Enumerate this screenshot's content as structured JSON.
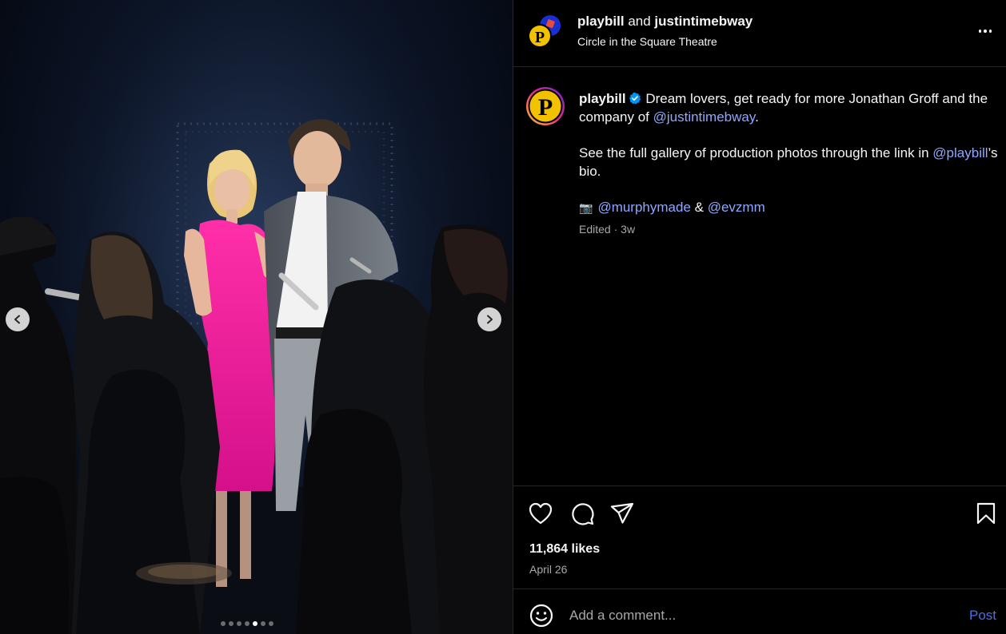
{
  "post": {
    "author": "playbill",
    "and_text": "and",
    "collaborator": "justintimebway",
    "location": "Circle in the Square Theatre"
  },
  "media": {
    "slide_count": 7,
    "active_slide": 5
  },
  "caption": {
    "username": "playbill",
    "line1_text": "Dream lovers, get ready for more Jonathan Groff and the company of ",
    "line1_mention": "@justintimebway",
    "line1_end": ".",
    "line2_text": "See the full gallery of production photos through the link in ",
    "line2_mention": "@playbill",
    "line2_end": "’s bio.",
    "camera_emoji": "📷",
    "credit1": "@murphymade",
    "credit_joiner": " & ",
    "credit2": "@evzmm",
    "edited": "Edited",
    "separator": " · ",
    "time_ago": "3w"
  },
  "engagement": {
    "likes": "11,864 likes",
    "date": "April 26"
  },
  "comment": {
    "placeholder": "Add a comment...",
    "post_label": "Post"
  },
  "colors": {
    "background": "#000000",
    "link": "#8fa7ff",
    "post_button": "#4a6fe0",
    "playbill_yellow": "#f2c200",
    "verified_blue": "#0095f6"
  },
  "icons": {
    "like": "heart-icon",
    "comment": "speech-bubble-icon",
    "share": "paper-plane-icon",
    "save": "bookmark-icon",
    "emoji": "smiley-icon",
    "more": "ellipsis-icon",
    "prev": "chevron-left-icon",
    "next": "chevron-right-icon"
  }
}
